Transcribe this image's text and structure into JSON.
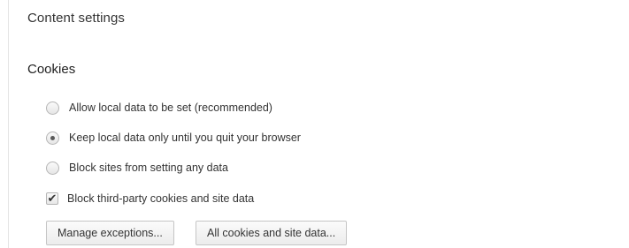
{
  "page": {
    "title": "Content settings"
  },
  "cookies": {
    "heading": "Cookies",
    "options": [
      {
        "label": "Allow local data to be set (recommended)",
        "type": "radio",
        "selected": false
      },
      {
        "label": "Keep local data only until you quit your browser",
        "type": "radio",
        "selected": true
      },
      {
        "label": "Block sites from setting any data",
        "type": "radio",
        "selected": false
      }
    ],
    "third_party": {
      "label": "Block third-party cookies and site data",
      "checked": true,
      "check_glyph": "✔"
    },
    "buttons": {
      "manage_exceptions": "Manage exceptions...",
      "all_cookies": "All cookies and site data..."
    }
  }
}
